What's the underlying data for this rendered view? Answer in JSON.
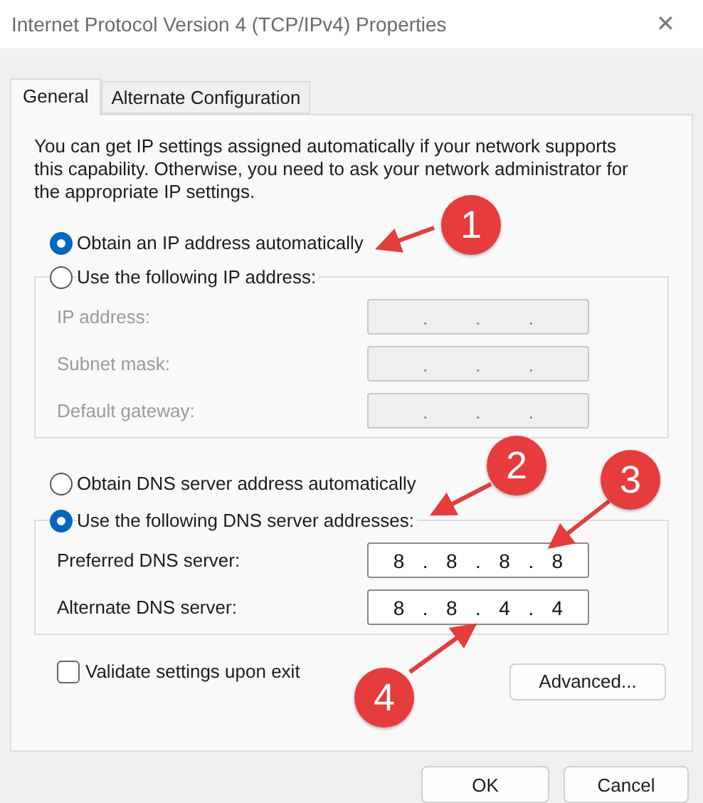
{
  "window": {
    "title": "Internet Protocol Version 4 (TCP/IPv4) Properties",
    "close": "✕"
  },
  "tabs": [
    {
      "label": "General",
      "selected": true
    },
    {
      "label": "Alternate Configuration",
      "selected": false
    }
  ],
  "intro": "You can get IP settings assigned automatically if your network supports this capability. Otherwise, you need to ask your network administrator for the appropriate IP settings.",
  "ip_auto": {
    "label": "Obtain an IP address automatically",
    "selected": true
  },
  "ip_manual": {
    "label": "Use the following IP address:",
    "selected": false,
    "disabled": true,
    "fields": [
      {
        "label": "IP address:",
        "parts": [
          ".",
          ".",
          "."
        ]
      },
      {
        "label": "Subnet mask:",
        "parts": [
          ".",
          ".",
          "."
        ]
      },
      {
        "label": "Default gateway:",
        "parts": [
          ".",
          ".",
          "."
        ]
      }
    ]
  },
  "dns_auto": {
    "label": "Obtain DNS server address automatically",
    "selected": false
  },
  "dns_manual": {
    "label": "Use the following DNS server addresses:",
    "selected": true,
    "disabled": false,
    "fields": [
      {
        "label": "Preferred DNS server:",
        "parts": [
          "8",
          ".",
          "8",
          ".",
          "8",
          ".",
          "8"
        ]
      },
      {
        "label": "Alternate DNS server:",
        "parts": [
          "8",
          ".",
          "8",
          ".",
          "4",
          ".",
          "4"
        ]
      }
    ]
  },
  "validate": {
    "label": "Validate settings upon exit",
    "checked": false
  },
  "advanced_button": "Advanced...",
  "buttons": [
    "OK",
    "Cancel"
  ],
  "annotations": [
    {
      "label": "1"
    },
    {
      "label": "2"
    },
    {
      "label": "3"
    },
    {
      "label": "4"
    }
  ]
}
